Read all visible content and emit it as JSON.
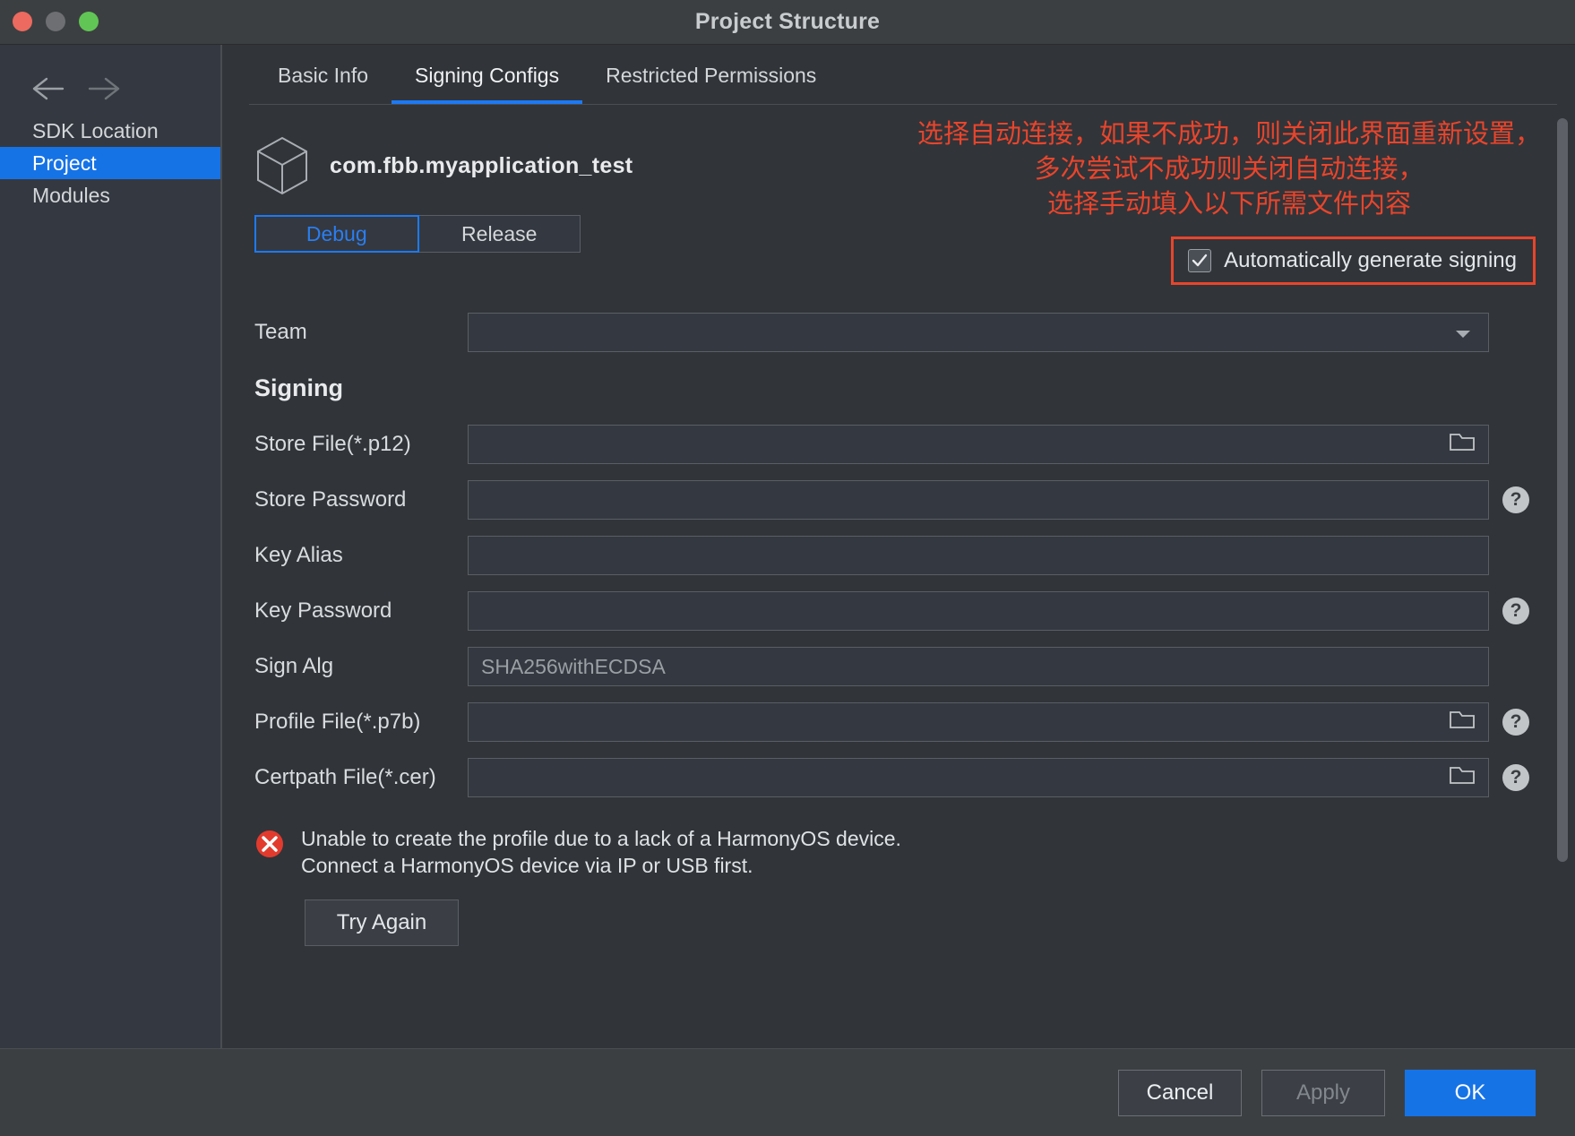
{
  "window": {
    "title": "Project Structure",
    "traffic_lights": [
      "close-button",
      "minimize-button",
      "maximize-button"
    ]
  },
  "sidebar": {
    "back_icon": "arrow-left-icon",
    "forward_icon": "arrow-right-icon",
    "items": [
      {
        "label": "SDK Location",
        "active": false
      },
      {
        "label": "Project",
        "active": true
      },
      {
        "label": "Modules",
        "active": false
      }
    ]
  },
  "tabs": [
    {
      "label": "Basic Info",
      "active": false
    },
    {
      "label": "Signing Configs",
      "active": true
    },
    {
      "label": "Restricted Permissions",
      "active": false
    }
  ],
  "app": {
    "icon": "cube-icon",
    "bundle_name": "com.fbb.myapplication_test"
  },
  "build_variants": [
    {
      "label": "Debug",
      "active": true
    },
    {
      "label": "Release",
      "active": false
    }
  ],
  "auto_generate": {
    "label": "Automatically generate signing",
    "checked": true,
    "highlight_color": "#e8452c"
  },
  "annotation": {
    "line1": "选择自动连接，如果不成功，则关闭此界面重新设置，",
    "line2": "多次尝试不成功则关闭自动连接，",
    "line3": "选择手动填入以下所需文件内容",
    "color": "#e8452c"
  },
  "team_row": {
    "label": "Team",
    "value": "",
    "arrow_icon": "chevron-down-icon"
  },
  "signing_section_title": "Signing",
  "signing_fields": [
    {
      "label": "Store File(*.p12)",
      "value": "",
      "has_folder": true,
      "has_help": false
    },
    {
      "label": "Store Password",
      "value": "",
      "has_folder": false,
      "has_help": true
    },
    {
      "label": "Key Alias",
      "value": "",
      "has_folder": false,
      "has_help": false
    },
    {
      "label": "Key Password",
      "value": "",
      "has_folder": false,
      "has_help": true
    },
    {
      "label": "Sign Alg",
      "value": "SHA256withECDSA",
      "has_folder": false,
      "has_help": false
    },
    {
      "label": "Profile File(*.p7b)",
      "value": "",
      "has_folder": true,
      "has_help": true
    },
    {
      "label": "Certpath File(*.cer)",
      "value": "",
      "has_folder": true,
      "has_help": true
    }
  ],
  "error": {
    "icon": "error-circle-icon",
    "line1": "Unable to create the profile due to a lack of a HarmonyOS device.",
    "line2": "Connect a HarmonyOS device via IP or USB first.",
    "retry_label": "Try Again",
    "color": "#e23b2e"
  },
  "footer": {
    "cancel_label": "Cancel",
    "apply_label": "Apply",
    "ok_label": "OK",
    "apply_enabled": false,
    "accent_color": "#1673e6"
  },
  "help_glyph": "?"
}
